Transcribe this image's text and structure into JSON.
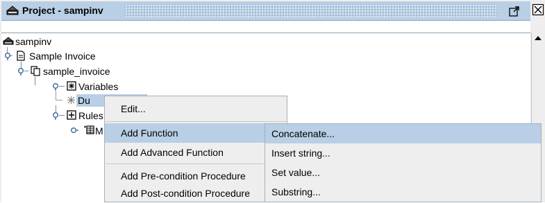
{
  "window": {
    "title": "Project - sampinv"
  },
  "tree": {
    "nodes": {
      "root": "sampinv",
      "invoice": "Sample Invoice",
      "schema": "sample_invoice",
      "variables": "Variables",
      "variable_item": "Du",
      "rules": "Rules",
      "rule_item": "M"
    }
  },
  "context_menu": {
    "items": [
      {
        "label": "Edit...",
        "has_submenu": false
      },
      {
        "label": "Add Function",
        "has_submenu": true,
        "selected": true
      },
      {
        "label": "Add Advanced Function",
        "has_submenu": true
      },
      {
        "label": "Add Pre-condition Procedure",
        "has_submenu": true
      },
      {
        "label": "Add Post-condition Procedure",
        "has_submenu": true
      }
    ]
  },
  "submenu": {
    "items": [
      {
        "label": "Concatenate...",
        "selected": true
      },
      {
        "label": "Insert string..."
      },
      {
        "label": "Set value..."
      },
      {
        "label": "Substring..."
      }
    ]
  },
  "colors": {
    "title_bar": "#b8cfe5",
    "selection": "#b8cfe5",
    "menu_bg": "#eeeeee"
  }
}
